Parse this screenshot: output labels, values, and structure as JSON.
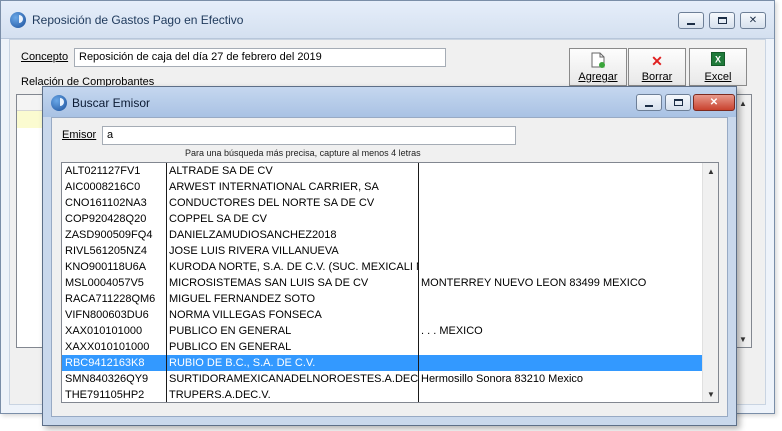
{
  "main_window": {
    "title": "Reposición de Gastos Pago en Efectivo",
    "concept_label": "Concepto",
    "concept_value": "Reposición de caja del día 27 de febrero del 2019",
    "relation_label": "Relación de Comprobantes",
    "buttons": {
      "add": "Agregar",
      "delete": "Borrar",
      "excel": "Excel"
    },
    "icons": {
      "add": "new-document-icon",
      "delete": "red-x-icon",
      "excel": "excel-icon"
    }
  },
  "dialog": {
    "title": "Buscar Emisor",
    "emisor_label": "Emisor",
    "emisor_value": "a",
    "hint": "Para una búsqueda más precisa, capture al menos 4 letras",
    "rows": [
      {
        "rfc": "ALT021127FV1",
        "name": "ALTRADE SA DE CV",
        "address": ""
      },
      {
        "rfc": "AIC0008216C0",
        "name": "ARWEST INTERNATIONAL CARRIER, SA",
        "address": ""
      },
      {
        "rfc": "CNO161102NA3",
        "name": "CONDUCTORES DEL NORTE SA DE CV",
        "address": ""
      },
      {
        "rfc": "COP920428Q20",
        "name": "COPPEL SA DE CV",
        "address": ""
      },
      {
        "rfc": "ZASD900509FQ4",
        "name": "DANIELZAMUDIOSANCHEZ2018",
        "address": ""
      },
      {
        "rfc": "RIVL561205NZ4",
        "name": "JOSE LUIS RIVERA VILLANUEVA",
        "address": ""
      },
      {
        "rfc": "KNO900118U6A",
        "name": "KURODA NORTE, S.A. DE C.V. (SUC. MEXICALI MAY",
        "address": ""
      },
      {
        "rfc": "MSL0004057V5",
        "name": "MICROSISTEMAS SAN LUIS SA DE CV",
        "address": "MONTERREY NUEVO LEON 83499 MEXICO"
      },
      {
        "rfc": "RACA711228QM6",
        "name": "MIGUEL FERNANDEZ SOTO",
        "address": ""
      },
      {
        "rfc": "VIFN800603DU6",
        "name": "NORMA VILLEGAS FONSECA",
        "address": ""
      },
      {
        "rfc": "XAX010101000",
        "name": "PUBLICO EN GENERAL",
        "address": ". . . MEXICO"
      },
      {
        "rfc": "XAXX010101000",
        "name": "PUBLICO EN GENERAL",
        "address": ""
      },
      {
        "rfc": "RBC9412163K8",
        "name": "RUBIO DE B.C., S.A. DE C.V.",
        "address": ""
      },
      {
        "rfc": "SMN840326QY9",
        "name": "SURTIDORAMEXICANADELNOROESTES.A.DEC.V.",
        "address": "Hermosillo Sonora 83210 Mexico"
      },
      {
        "rfc": "THE791105HP2",
        "name": "TRUPERS.A.DEC.V.",
        "address": ""
      }
    ],
    "selected_index": 12
  },
  "colors": {
    "selection": "#3399ff",
    "grid_highlight": "#fbfbd0",
    "close_button": "#c9422e"
  }
}
